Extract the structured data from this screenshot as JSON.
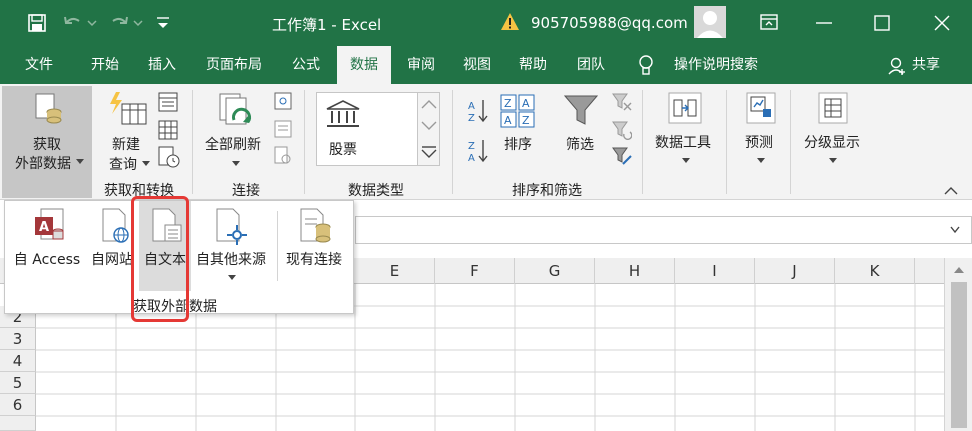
{
  "titlebar": {
    "title": "工作簿1  -  Excel",
    "account": "905705988@qq.com",
    "undo_icon": "undo-icon",
    "redo_icon": "redo-icon"
  },
  "tabs": [
    "文件",
    "开始",
    "插入",
    "页面布局",
    "公式",
    "数据",
    "审阅",
    "视图",
    "帮助",
    "团队"
  ],
  "active_tab": "数据",
  "tell_me": "操作说明搜索",
  "share": "共享",
  "ribbon": {
    "get_external": {
      "line1": "获取",
      "line2": "外部数据"
    },
    "new_query": {
      "line1": "新建",
      "line2": "查询"
    },
    "group_get_transform": "获取和转换",
    "refresh_all": "全部刷新",
    "group_connections": "连接",
    "stocks": "股票",
    "group_data_types": "数据类型",
    "sort": "排序",
    "filter": "筛选",
    "group_sort_filter": "排序和筛选",
    "data_tools": "数据工具",
    "forecast": "预测",
    "outline": "分级显示"
  },
  "popup": {
    "items": [
      "自 Access",
      "自网站",
      "自文本",
      "自其他来源",
      "现有连接"
    ],
    "group_label": "获取外部数据"
  },
  "columns": [
    "E",
    "F",
    "G",
    "H",
    "I",
    "J",
    "K"
  ],
  "rows": [
    "2",
    "3",
    "4",
    "5",
    "6"
  ],
  "colors": {
    "excel_green": "#217346",
    "highlight_red": "#e53935"
  }
}
